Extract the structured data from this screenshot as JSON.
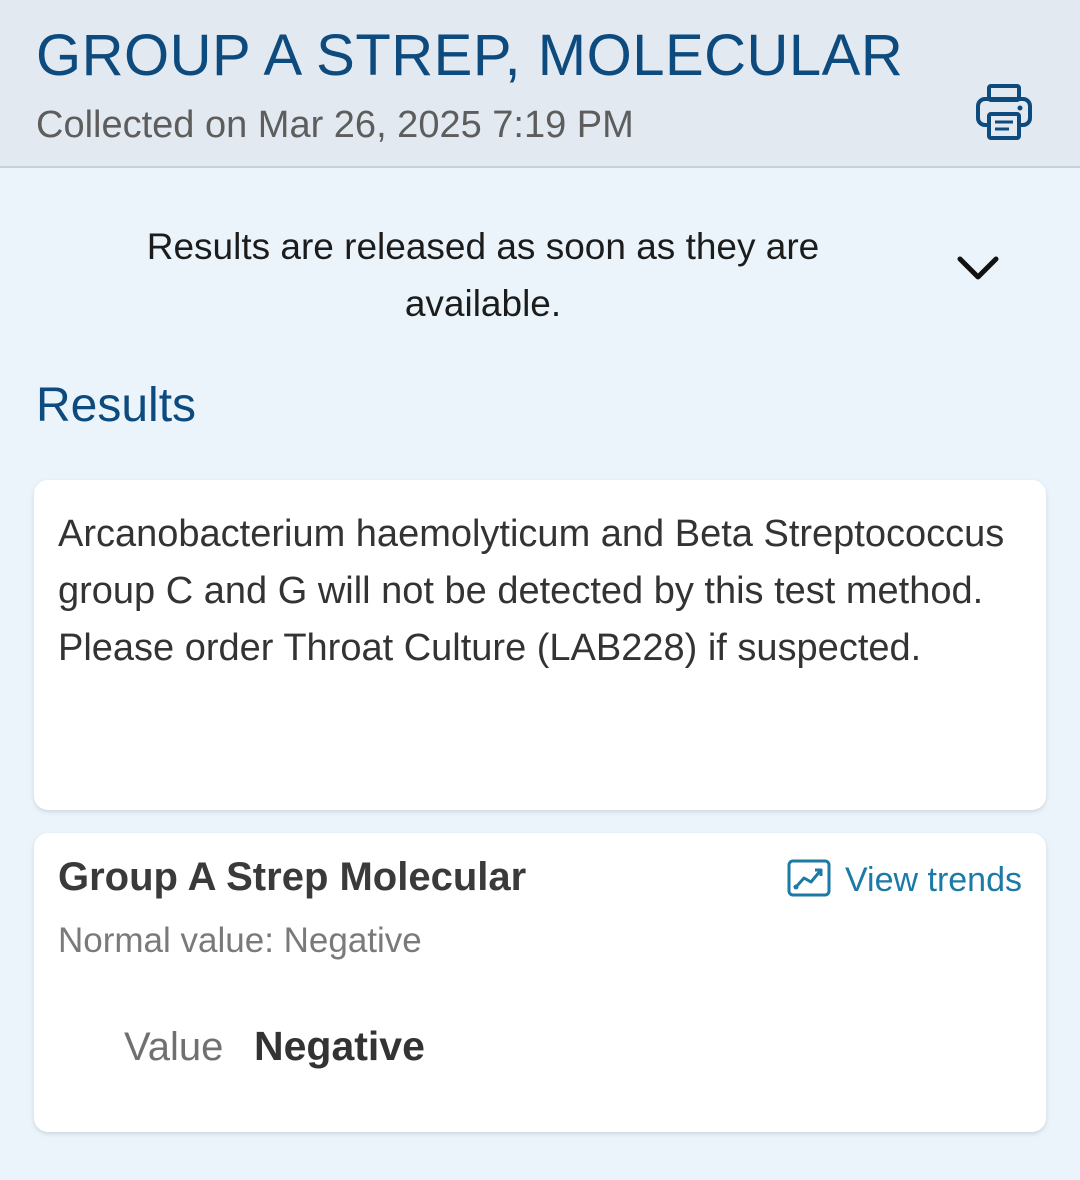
{
  "header": {
    "title": "GROUP A STREP, MOLECULAR",
    "collected": "Collected on Mar 26, 2025 7:19 PM",
    "print_icon": "printer-icon"
  },
  "release_notice": {
    "text": "Results are released as soon as they are available.",
    "toggle_icon": "chevron-down-icon"
  },
  "results": {
    "section_title": "Results",
    "note": "Arcanobacterium haemolyticum and Beta Streptococcus group C and G will not be detected by this test method.  Please order Throat Culture (LAB228) if suspected.",
    "component": {
      "name": "Group A Strep Molecular",
      "view_trends_label": "View trends",
      "trends_icon": "trend-chart-icon",
      "normal_value": "Normal value: Negative",
      "value_label": "Value",
      "value": "Negative"
    }
  },
  "colors": {
    "accent": "#0d4a7e",
    "link": "#1b7aa6",
    "header_bg": "#e2e9f0",
    "page_bg": "#eaf4fa"
  }
}
